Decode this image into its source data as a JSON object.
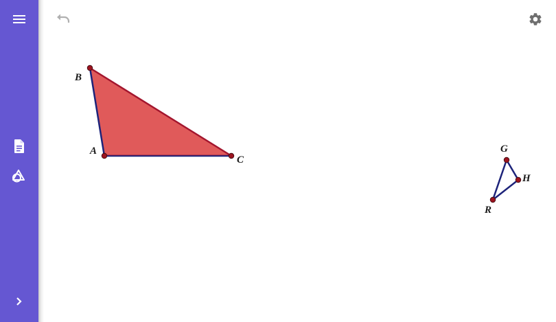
{
  "sidebar": {
    "icons": [
      "menu-icon",
      "document-icon",
      "shapes-icon",
      "chevron-right-icon"
    ]
  },
  "toolbar": {
    "icons": [
      "undo-icon",
      "gear-icon"
    ]
  },
  "colors": {
    "sidebar": "#6557d2",
    "triangle_fill": "#e05a5a",
    "edge": "#1d237a",
    "edge_highlight": "#a3162e",
    "point": "#9c1420"
  },
  "points": {
    "A": {
      "label": "A"
    },
    "B": {
      "label": "B"
    },
    "C": {
      "label": "C"
    },
    "G": {
      "label": "G"
    },
    "H": {
      "label": "H"
    },
    "R": {
      "label": "R"
    }
  }
}
